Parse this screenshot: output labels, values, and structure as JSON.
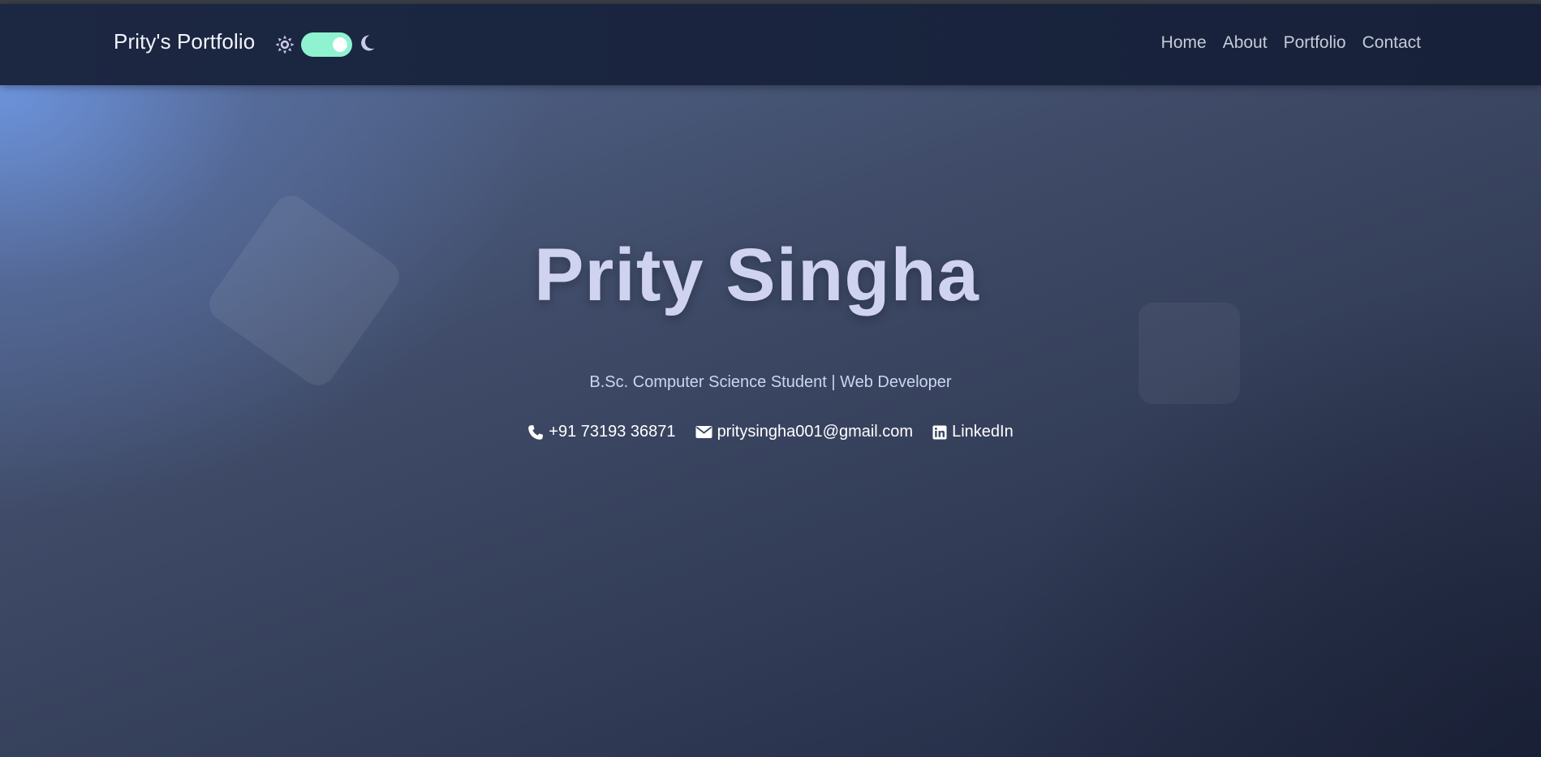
{
  "navbar": {
    "brand": "Prity's Portfolio",
    "theme_toggle": {
      "state": "dark",
      "track_color": "#8ff2d1"
    },
    "icons": {
      "light": "sun-icon",
      "dark": "moon-icon"
    },
    "links": [
      {
        "label": "Home"
      },
      {
        "label": "About"
      },
      {
        "label": "Portfolio"
      },
      {
        "label": "Contact"
      }
    ]
  },
  "hero": {
    "name": "Prity Singha",
    "subtitle": "B.Sc. Computer Science Student | Web Developer",
    "contacts": [
      {
        "icon": "phone-icon",
        "text": "+91 73193 36871"
      },
      {
        "icon": "envelope-icon",
        "text": "pritysingha001@gmail.com"
      },
      {
        "icon": "linkedin-icon",
        "text": "LinkedIn"
      }
    ]
  },
  "colors": {
    "accent": "#8ff2d1",
    "navbar_bg": "#1c2742",
    "title": "#cfd3f0"
  }
}
